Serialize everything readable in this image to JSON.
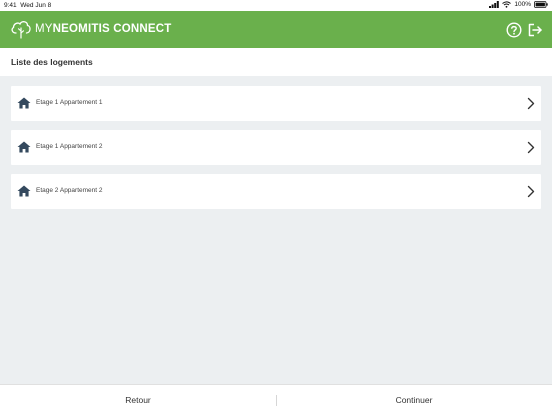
{
  "status_bar": {
    "time": "9:41",
    "date": "Wed Jun 8",
    "battery": "100%"
  },
  "header": {
    "logo_prefix": "MY",
    "logo_brand": "NEOMITIS CONNECT",
    "help_icon": "help-circle-icon",
    "logout_icon": "logout-icon",
    "color": "#6ab04c"
  },
  "page": {
    "title": "Liste des logements"
  },
  "list": {
    "items": [
      {
        "label": "Etage 1 Appartement 1"
      },
      {
        "label": "Etage 1 Appartement 2"
      },
      {
        "label": "Etage 2 Appartement 2"
      }
    ]
  },
  "footer": {
    "back_label": "Retour",
    "next_label": "Continuer"
  }
}
